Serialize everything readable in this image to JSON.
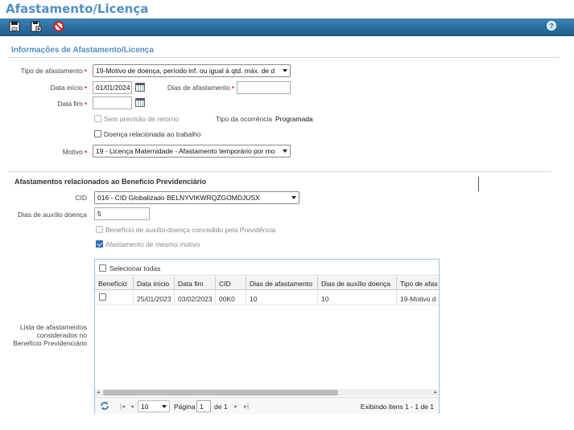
{
  "page": {
    "title": "Afastamento/Licença"
  },
  "toolbar": {
    "buttons": [
      {
        "icon": "save-icon"
      },
      {
        "icon": "save-as-icon"
      },
      {
        "icon": "cancel-icon"
      }
    ],
    "help_icon": "help-icon",
    "help_label": "?"
  },
  "form": {
    "section_title": "Informações de Afastamento/Licença",
    "tipo_afastamento": {
      "label": "Tipo de afastamento",
      "value": "19-Motivo de doença, período inf. ou igual à qtd. máx. de d"
    },
    "data_inicio": {
      "label": "Data início",
      "value": "01/01/2024"
    },
    "dias_afastamento": {
      "label": "Dias de afastamento",
      "value": ""
    },
    "data_fim": {
      "label": "Data fim",
      "value": ""
    },
    "sem_previsao": {
      "label": "Sem previsão de retorno",
      "checked": false
    },
    "tipo_ocorrencia": {
      "label": "Tipo da ocorrência",
      "value": "Programada"
    },
    "doenca_relacionada": {
      "label": "Doença relacionada ao trabalho",
      "checked": false
    },
    "motivo": {
      "label": "Motivo",
      "value": "19 - Licença Maternidade - Afastamento temporário por mo"
    }
  },
  "beneficio": {
    "section_title": "Afastamentos relacionados ao Benefício Previdenciário",
    "cid": {
      "label": "CID",
      "value": "016 - CID Globalizado BELNYVIKWRQZGOMDJUSX"
    },
    "dias_auxilio": {
      "label": "Dias de auxílio doença",
      "value": "5"
    },
    "beneficio_concedido": {
      "label": "Benefício de auxílio-doença concedido pela Previdência",
      "checked": false
    },
    "mesmo_motivo": {
      "label": "Afastamento de mesmo motivo",
      "checked": true
    },
    "lista_label": "Lista de afastamentos considerados no Benefício Previdenciário"
  },
  "grid": {
    "select_all_label": "Selecionar todas",
    "columns": [
      "Benefício",
      "Data início",
      "Data fim",
      "CID",
      "Dias de afastamento",
      "Dias de auxílio doença",
      "Tipo de afas"
    ],
    "rows": [
      {
        "checked": false,
        "cells": [
          "",
          "25/01/2023",
          "03/02/2023",
          "00K0",
          "10",
          "10",
          "19-Motivo d"
        ]
      }
    ],
    "pager": {
      "page_size": "10",
      "page_label": "Página",
      "page_value": "1",
      "of_label": "de 1",
      "status": "Exibindo itens 1 - 1 de 1"
    }
  },
  "colors": {
    "title": "#4f8fc7",
    "toolbar": "#2b6d9e",
    "required": "#d22222",
    "accent": "#2e6fb2"
  }
}
